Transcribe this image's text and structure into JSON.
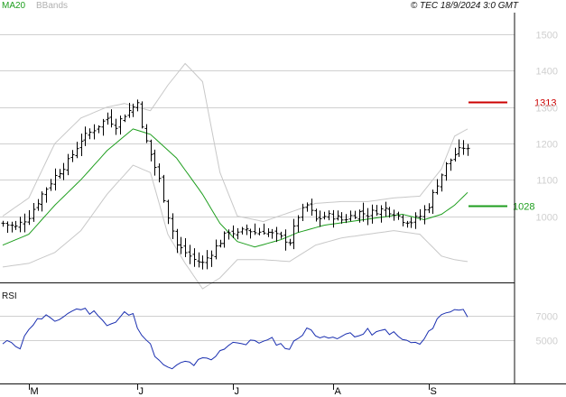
{
  "legend": {
    "ma_label": "MA20",
    "bb_label": "BBands"
  },
  "copyright": "© TEC 18/9/2024 3:0 GMT",
  "rsi_label": "RSI",
  "colors": {
    "price": "#000000",
    "ma": "#1e9e1e",
    "bands": "#c8c8c8",
    "rsi": "#1a2fb0",
    "resistance": "#cc0000",
    "support": "#1e9e1e",
    "grid": "#d0d0d0",
    "axis_text": "#cfcfcf"
  },
  "chart_data": [
    {
      "type": "ohlc",
      "title": "",
      "y_ticks": [
        1000,
        1100,
        1200,
        1300,
        1400,
        1500
      ],
      "y_tick_labels": [
        "1000",
        "1100",
        "1200",
        "1300",
        "1400",
        "1500"
      ],
      "ylim": [
        820,
        1560
      ],
      "x_labels": [
        {
          "label": "M",
          "bar": 6
        },
        {
          "label": "J",
          "bar": 31
        },
        {
          "label": "J",
          "bar": 53
        },
        {
          "label": "A",
          "bar": 76
        },
        {
          "label": "S",
          "bar": 98
        }
      ],
      "bar_count": 108,
      "close_keypoints": [
        [
          0,
          980
        ],
        [
          3,
          970
        ],
        [
          6,
          1000
        ],
        [
          9,
          1060
        ],
        [
          12,
          1110
        ],
        [
          15,
          1150
        ],
        [
          18,
          1210
        ],
        [
          21,
          1240
        ],
        [
          24,
          1270
        ],
        [
          26,
          1250
        ],
        [
          28,
          1280
        ],
        [
          30,
          1300
        ],
        [
          31,
          1320
        ],
        [
          32,
          1240
        ],
        [
          34,
          1170
        ],
        [
          36,
          1100
        ],
        [
          38,
          1000
        ],
        [
          40,
          920
        ],
        [
          42,
          900
        ],
        [
          44,
          880
        ],
        [
          46,
          870
        ],
        [
          48,
          900
        ],
        [
          50,
          930
        ],
        [
          52,
          960
        ],
        [
          54,
          950
        ],
        [
          56,
          965
        ],
        [
          58,
          955
        ],
        [
          60,
          960
        ],
        [
          62,
          950
        ],
        [
          64,
          940
        ],
        [
          66,
          930
        ],
        [
          68,
          1000
        ],
        [
          70,
          1030
        ],
        [
          72,
          990
        ],
        [
          74,
          1000
        ],
        [
          76,
          1000
        ],
        [
          78,
          990
        ],
        [
          80,
          1000
        ],
        [
          82,
          1010
        ],
        [
          84,
          1005
        ],
        [
          86,
          1015
        ],
        [
          88,
          1020
        ],
        [
          90,
          1010
        ],
        [
          92,
          990
        ],
        [
          94,
          985
        ],
        [
          96,
          1000
        ],
        [
          98,
          1030
        ],
        [
          100,
          1090
        ],
        [
          102,
          1140
        ],
        [
          104,
          1170
        ],
        [
          106,
          1190
        ],
        [
          107,
          1180
        ]
      ],
      "ma20_keypoints": [
        [
          0,
          920
        ],
        [
          6,
          950
        ],
        [
          12,
          1030
        ],
        [
          18,
          1100
        ],
        [
          24,
          1180
        ],
        [
          30,
          1240
        ],
        [
          34,
          1225
        ],
        [
          40,
          1160
        ],
        [
          46,
          1060
        ],
        [
          50,
          980
        ],
        [
          54,
          930
        ],
        [
          58,
          915
        ],
        [
          64,
          935
        ],
        [
          68,
          955
        ],
        [
          74,
          975
        ],
        [
          80,
          985
        ],
        [
          86,
          995
        ],
        [
          92,
          1005
        ],
        [
          97,
          990
        ],
        [
          101,
          1005
        ],
        [
          104,
          1030
        ],
        [
          107,
          1065
        ]
      ],
      "bb_upper_keypoints": [
        [
          0,
          1000
        ],
        [
          6,
          1050
        ],
        [
          12,
          1200
        ],
        [
          18,
          1270
        ],
        [
          24,
          1300
        ],
        [
          28,
          1310
        ],
        [
          34,
          1290
        ],
        [
          38,
          1360
        ],
        [
          42,
          1420
        ],
        [
          46,
          1370
        ],
        [
          50,
          1120
        ],
        [
          54,
          1000
        ],
        [
          60,
          985
        ],
        [
          66,
          1010
        ],
        [
          72,
          1035
        ],
        [
          78,
          1040
        ],
        [
          84,
          1040
        ],
        [
          90,
          1050
        ],
        [
          96,
          1055
        ],
        [
          101,
          1130
        ],
        [
          104,
          1220
        ],
        [
          107,
          1240
        ]
      ],
      "bb_lower_keypoints": [
        [
          0,
          860
        ],
        [
          6,
          870
        ],
        [
          12,
          900
        ],
        [
          18,
          960
        ],
        [
          24,
          1060
        ],
        [
          30,
          1140
        ],
        [
          34,
          1120
        ],
        [
          38,
          950
        ],
        [
          42,
          870
        ],
        [
          46,
          800
        ],
        [
          50,
          830
        ],
        [
          54,
          880
        ],
        [
          60,
          880
        ],
        [
          66,
          875
        ],
        [
          72,
          920
        ],
        [
          78,
          940
        ],
        [
          84,
          950
        ],
        [
          90,
          960
        ],
        [
          96,
          950
        ],
        [
          101,
          890
        ],
        [
          104,
          880
        ],
        [
          107,
          875
        ]
      ],
      "levels": [
        {
          "value": 1313,
          "label": "1313",
          "color": "#cc0000"
        },
        {
          "value": 1028,
          "label": "1028",
          "color": "#1e9e1e"
        }
      ]
    },
    {
      "type": "line",
      "title": "RSI",
      "y_ticks": [
        50,
        70
      ],
      "y_tick_labels": [
        "5000",
        "7000"
      ],
      "ylim": [
        15,
        95
      ],
      "rsi_keypoints": [
        [
          0,
          46
        ],
        [
          2,
          49
        ],
        [
          4,
          44
        ],
        [
          6,
          60
        ],
        [
          8,
          66
        ],
        [
          10,
          70
        ],
        [
          12,
          63
        ],
        [
          14,
          70
        ],
        [
          16,
          74
        ],
        [
          18,
          76
        ],
        [
          20,
          73
        ],
        [
          22,
          72
        ],
        [
          24,
          62
        ],
        [
          26,
          64
        ],
        [
          28,
          72
        ],
        [
          30,
          70
        ],
        [
          31,
          62
        ],
        [
          32,
          56
        ],
        [
          34,
          45
        ],
        [
          36,
          32
        ],
        [
          38,
          26
        ],
        [
          40,
          28
        ],
        [
          42,
          32
        ],
        [
          44,
          30
        ],
        [
          46,
          34
        ],
        [
          48,
          33
        ],
        [
          50,
          40
        ],
        [
          52,
          47
        ],
        [
          54,
          49
        ],
        [
          56,
          46
        ],
        [
          58,
          50
        ],
        [
          60,
          48
        ],
        [
          62,
          50
        ],
        [
          64,
          46
        ],
        [
          66,
          43
        ],
        [
          68,
          52
        ],
        [
          70,
          60
        ],
        [
          72,
          53
        ],
        [
          74,
          55
        ],
        [
          76,
          50
        ],
        [
          78,
          52
        ],
        [
          80,
          56
        ],
        [
          82,
          53
        ],
        [
          84,
          57
        ],
        [
          86,
          55
        ],
        [
          88,
          58
        ],
        [
          90,
          55
        ],
        [
          92,
          50
        ],
        [
          94,
          48
        ],
        [
          96,
          46
        ],
        [
          98,
          55
        ],
        [
          100,
          68
        ],
        [
          102,
          72
        ],
        [
          104,
          76
        ],
        [
          106,
          74
        ],
        [
          107,
          70
        ]
      ]
    }
  ]
}
